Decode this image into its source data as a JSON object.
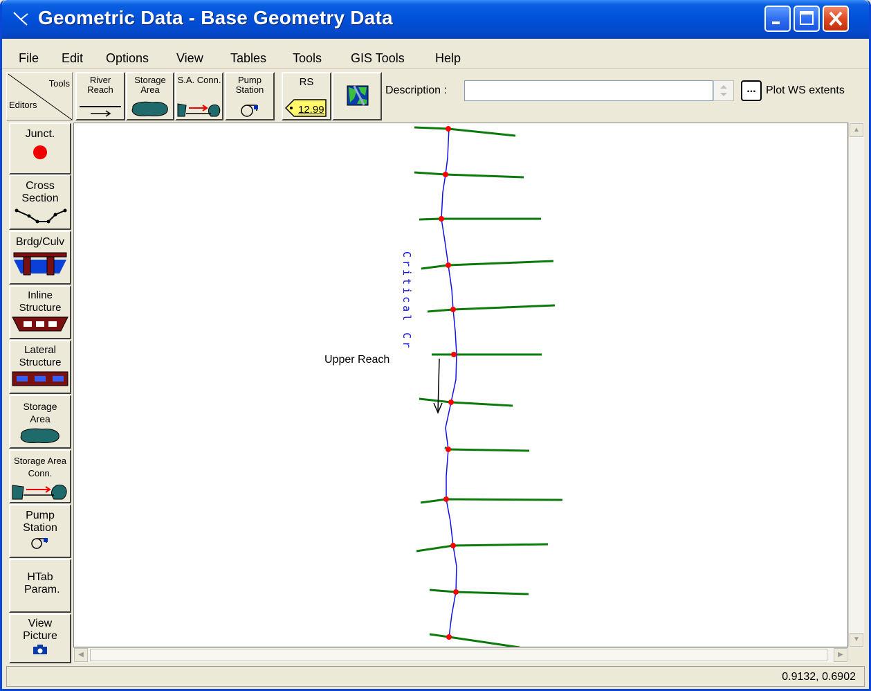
{
  "window": {
    "title": "Geometric Data - Base Geometry Data"
  },
  "menu": [
    "File",
    "Edit",
    "Options",
    "View",
    "Tables",
    "Tools",
    "GIS Tools",
    "Help"
  ],
  "toolbar": {
    "corner_top": "Tools",
    "corner_bottom": "Editors",
    "river_reach": "River Reach",
    "storage_area": "Storage Area",
    "sa_conn": "S.A. Conn.",
    "pump_station": "Pump Station",
    "rs": "RS",
    "rs_tag": "12.99",
    "description_label": "Description :",
    "description_value": "",
    "dots": "...",
    "plot_ws": "Plot WS extents"
  },
  "editors": {
    "junct": "Junct.",
    "cross_section": "Cross Section",
    "bridge_culvert": "Brdg/Culv",
    "inline_structure": "Inline Structure",
    "lateral_structure": "Lateral Structure",
    "storage_area": "Storage Area",
    "storage_area_conn": "Storage Area Conn.",
    "pump_station": "Pump Station",
    "htab": "HTab Param.",
    "view_picture": "View Picture"
  },
  "canvas": {
    "river_name": "Critical Cr",
    "reach_name": "Upper Reach",
    "colors": {
      "river": "#1010e8",
      "xs": "#0a7a0a",
      "node": "#ff0000"
    }
  },
  "status": {
    "coords": "0.9132, 0.6902"
  }
}
